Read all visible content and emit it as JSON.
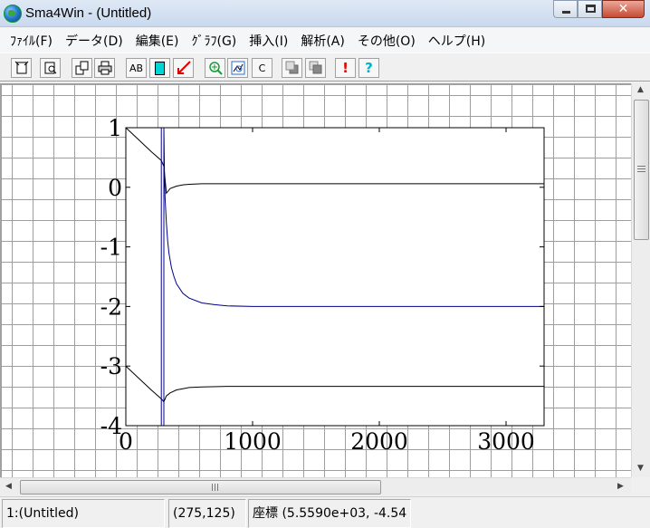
{
  "window": {
    "title": "Sma4Win - (Untitled)",
    "close_glyph": "✕"
  },
  "menu": [
    "ﾌｧｲﾙ(F)",
    "データ(D)",
    "編集(E)",
    "ｸﾞﾗﾌ(G)",
    "挿入(I)",
    "解析(A)",
    "その他(O)",
    "ヘルプ(H)"
  ],
  "toolbar": {
    "text_button_label": "AB",
    "clear_button_label": "C",
    "marker_glyph": "!",
    "help_glyph": "?",
    "icons": [
      "new-doc-icon",
      "preview-icon",
      "copy-icon",
      "print-icon",
      "text-icon",
      "rect-icon",
      "arrow-line-icon",
      "zoom-in-icon",
      "zoom-fit-icon",
      "clear-icon",
      "bring-front-icon",
      "send-back-icon",
      "marker-icon",
      "help-icon"
    ]
  },
  "scroll": {
    "up": "▲",
    "down": "▼",
    "left": "◀",
    "right": "▶"
  },
  "status": {
    "document": "1:(Untitled)",
    "cursor": "(275,125)",
    "coords": "座標 (5.5590e+03, -4.54"
  },
  "chart_data": {
    "type": "line",
    "xlim": [
      0,
      3300
    ],
    "ylim": [
      -4,
      1
    ],
    "xticks": [
      0,
      1000,
      2000,
      3000
    ],
    "yticks": [
      1,
      0,
      -1,
      -2,
      -3,
      -4
    ],
    "xtick_labels": [
      "0",
      "1000",
      "2000",
      "3000"
    ],
    "ytick_labels": [
      "1",
      "0",
      "-1",
      "-2",
      "-3",
      "-4"
    ],
    "grid": false,
    "colors": {
      "black": "#000000",
      "blue": "#00008b"
    },
    "series": [
      {
        "color": "#000000",
        "x": [
          0,
          100,
          200,
          280,
          300,
          320,
          350,
          400,
          450,
          500,
          600,
          800,
          1000,
          2000,
          3300
        ],
        "y": [
          1,
          0.8,
          0.6,
          0.45,
          0.35,
          -0.1,
          -0.02,
          0.02,
          0.04,
          0.05,
          0.06,
          0.06,
          0.06,
          0.06,
          0.06
        ]
      },
      {
        "color": "#000000",
        "x": [
          0,
          100,
          200,
          280,
          300,
          320,
          350,
          400,
          450,
          500,
          600,
          800,
          1000,
          2000,
          3300
        ],
        "y": [
          -3,
          -3.2,
          -3.4,
          -3.55,
          -3.6,
          -3.5,
          -3.45,
          -3.4,
          -3.38,
          -3.36,
          -3.35,
          -3.34,
          -3.34,
          -3.34,
          -3.34
        ]
      },
      {
        "color": "#00008b",
        "x": [
          300,
          300,
          305,
          310,
          320,
          330,
          340,
          360,
          380,
          400,
          450,
          500,
          600,
          700,
          800,
          1000,
          1500,
          2000,
          3300
        ],
        "y": [
          -4,
          1,
          0.2,
          -0.2,
          -0.6,
          -0.9,
          -1.1,
          -1.35,
          -1.5,
          -1.62,
          -1.78,
          -1.86,
          -1.94,
          -1.97,
          -1.99,
          -2.0,
          -2.0,
          -2.0,
          -2.0
        ]
      },
      {
        "color": "#00008b",
        "x": [
          280,
          280
        ],
        "y": [
          -4,
          1
        ]
      }
    ]
  }
}
